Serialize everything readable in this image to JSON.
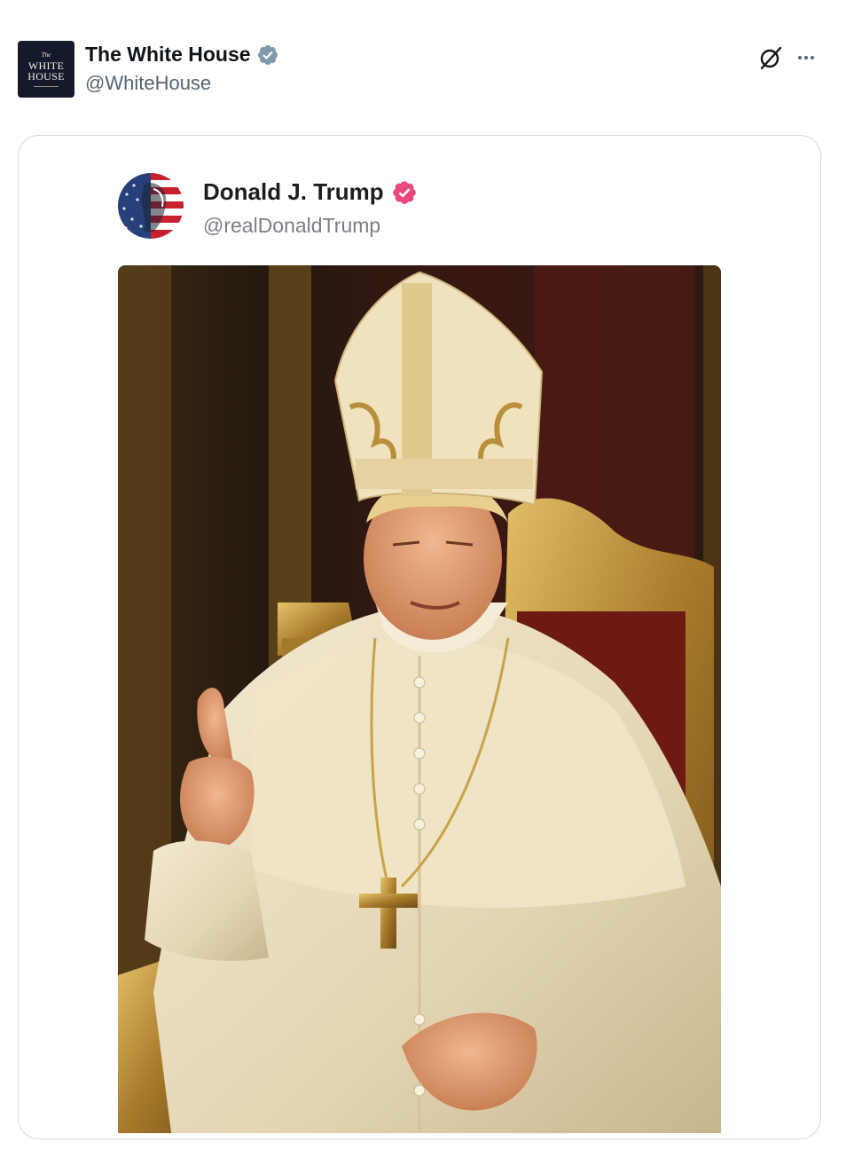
{
  "post": {
    "author": {
      "name": "The White House",
      "handle": "@WhiteHouse",
      "avatar_lines": [
        "The",
        "WHITE",
        "HOUSE"
      ],
      "verified_icon": "verified-badge-icon",
      "verified_color": "#829aab"
    },
    "actions": [
      "grok-icon",
      "more-icon"
    ]
  },
  "quoted_post": {
    "author": {
      "name": "Donald J. Trump",
      "handle": "@realDonaldTrump",
      "verified_icon": "verified-badge-icon",
      "verified_color": "#e8477f"
    },
    "image": {
      "subject_icon": "ai-generated-pope-portrait-image"
    }
  },
  "colors": {
    "text_primary": "#0f1419",
    "text_secondary": "#536471",
    "card_border": "#cfd9de"
  }
}
